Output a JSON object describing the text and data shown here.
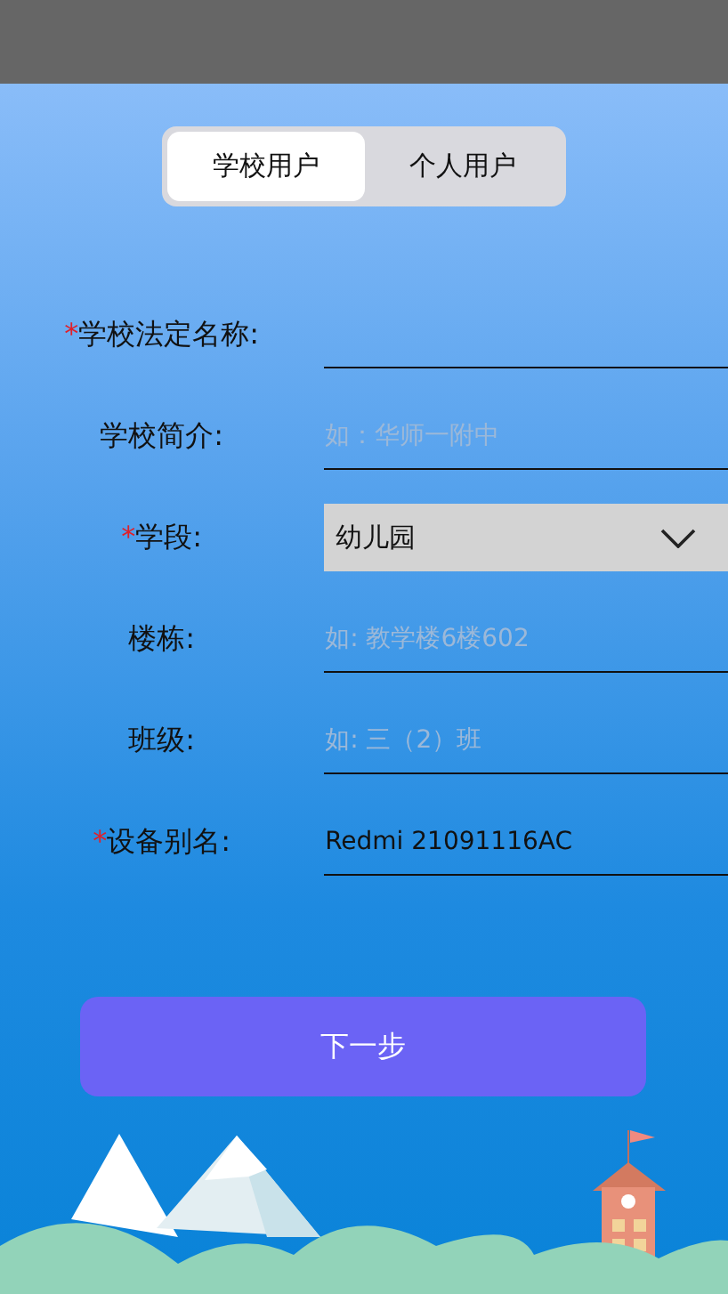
{
  "tabs": [
    {
      "label": "学校用户",
      "selected": true
    },
    {
      "label": "个人用户",
      "selected": false
    }
  ],
  "fields": [
    {
      "required_mark": "*",
      "label": "学校法定名称:",
      "kind": "input"
    },
    {
      "label": "学校简介:",
      "kind": "input",
      "placeholder": "如：华师一附中"
    },
    {
      "required_mark": "*",
      "label": "学段:",
      "kind": "select",
      "value": "幼儿园"
    },
    {
      "label": "楼栋:",
      "kind": "input",
      "placeholder": "如: 教学楼6楼602"
    },
    {
      "label": "班级:",
      "kind": "input",
      "placeholder": "如: 三（2）班"
    },
    {
      "required_mark": "*",
      "label": "设备别名:",
      "kind": "input",
      "value": "Redmi 21091116AC"
    }
  ],
  "next_button": "下一步"
}
